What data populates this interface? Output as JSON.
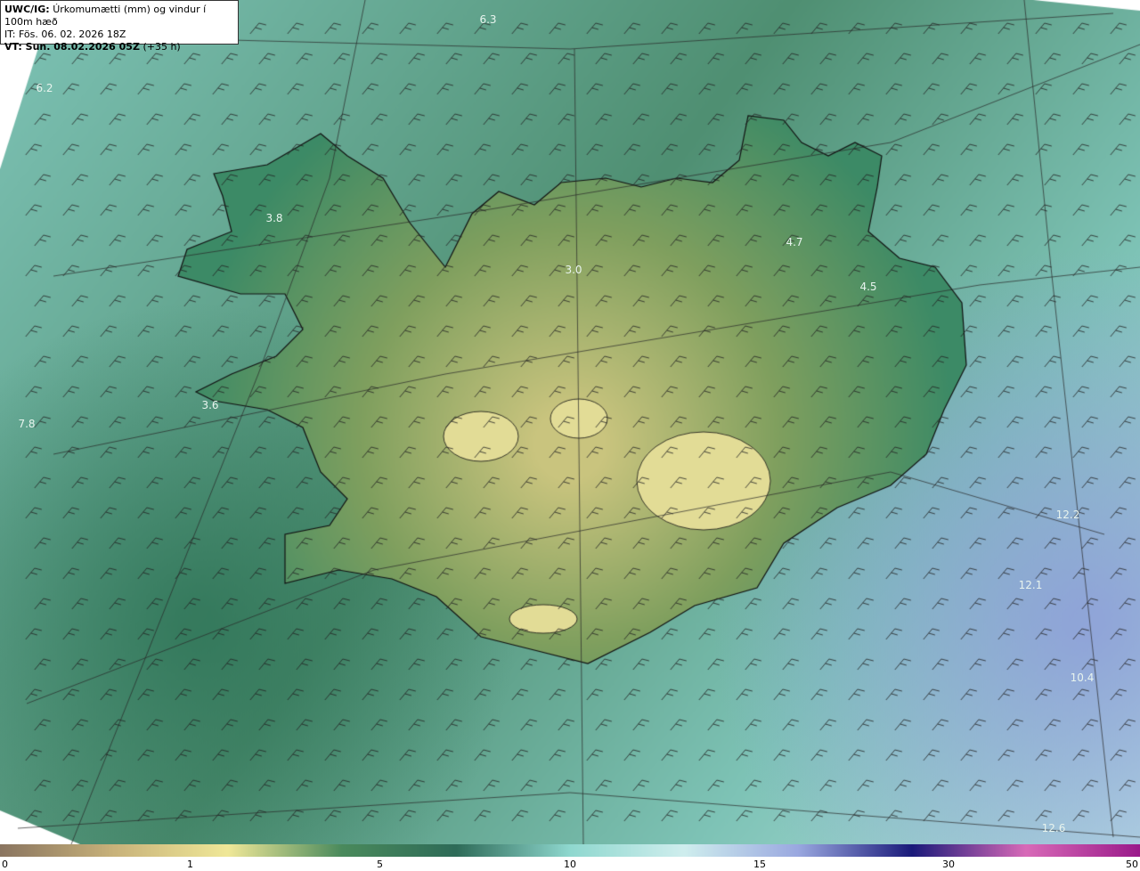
{
  "header": {
    "model": "UWC/IG:",
    "title": "Úrkomumætti (mm) og vindur í 100m hæð",
    "it": "IT: Fös. 06. 02. 2026 18Z",
    "vt_label": "VT: Sun. 08.02.2026 05Z",
    "vt_offset": "(+35 h)"
  },
  "value_labels": [
    "6.3",
    "6.2",
    "3.8",
    "3.6",
    "7.8",
    "3.0",
    "4.7",
    "4.5",
    "12.2",
    "12.1",
    "10.4",
    "12.6"
  ],
  "colorbar": {
    "ticks": [
      "0",
      "1",
      "5",
      "10",
      "15",
      "30",
      "50"
    ],
    "colors": [
      "#8a7560",
      "#c8b27a",
      "#f0e898",
      "#4a8a5c",
      "#2e6b58",
      "#8fd8cf",
      "#cfeeee",
      "#9aa8e0",
      "#1a1a7a",
      "#d86ab8",
      "#9a1a8a"
    ]
  },
  "palette": {
    "ocean_low": "#4f8f72",
    "ocean_mid": "#7ec3b6",
    "ocean_high": "#b9e3e2",
    "land_high": "#c9c47e",
    "land_mid": "#7f9f5e",
    "coast": "#111111",
    "barb": "#222222"
  }
}
